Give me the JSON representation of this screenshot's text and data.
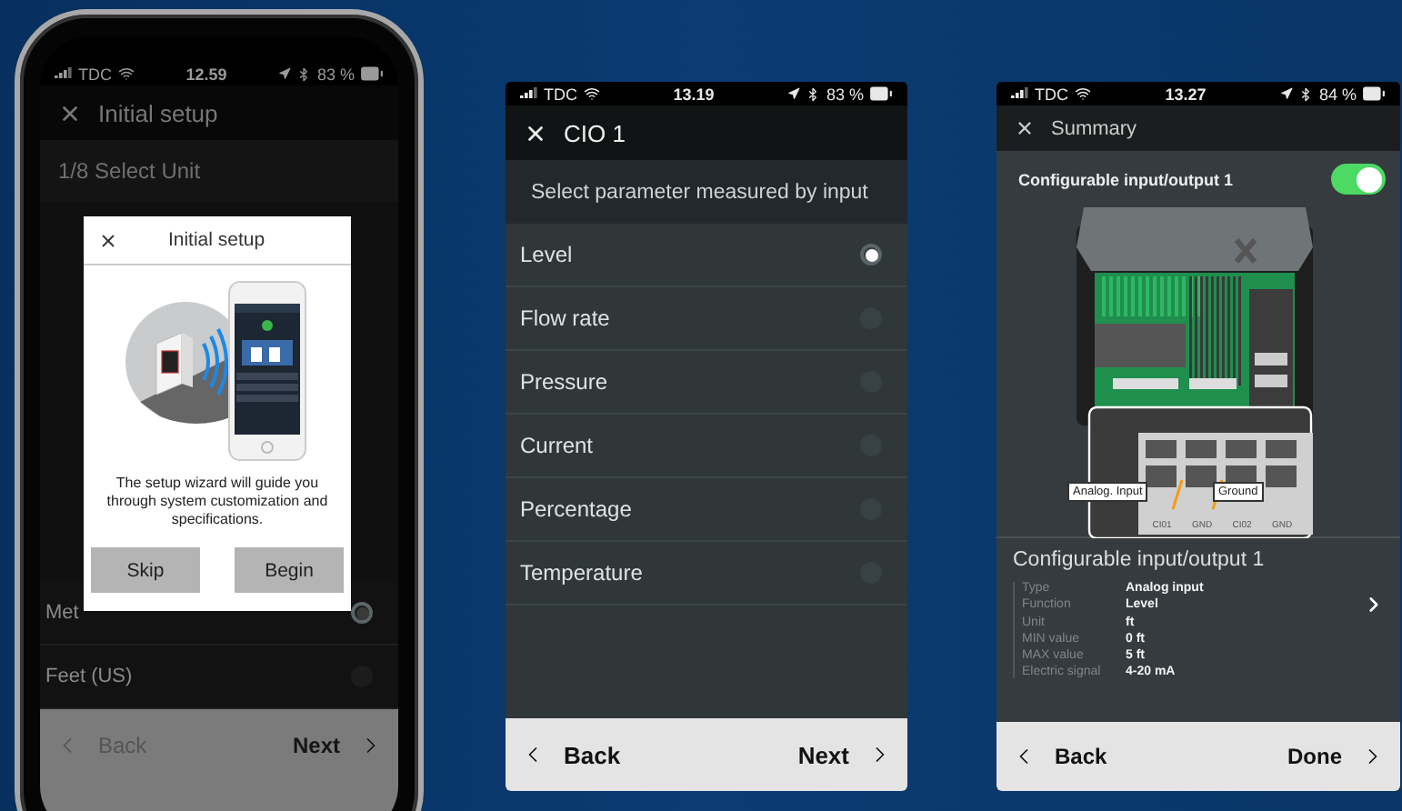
{
  "phones": [
    {
      "kind": "setup",
      "status": {
        "carrier": "TDC",
        "time": "12.59",
        "battery": "83 %"
      },
      "header": {
        "title": "Initial setup"
      },
      "step": "1/8 Select Unit",
      "options": [
        {
          "label": "Met",
          "selected": true
        },
        {
          "label": "Feet (US)",
          "selected": false
        }
      ],
      "footer": {
        "back": "Back",
        "next": "Next"
      },
      "dialog": {
        "title": "Initial setup",
        "message": "The setup wizard will guide you through system customization and specifications.",
        "buttons": [
          "Skip",
          "Begin"
        ]
      }
    },
    {
      "kind": "select",
      "status": {
        "carrier": "TDC",
        "time": "13.19",
        "battery": "83 %"
      },
      "header": {
        "title": "CIO 1"
      },
      "prompt": "Select parameter measured by input",
      "options": [
        {
          "label": "Level",
          "selected": true
        },
        {
          "label": "Flow rate",
          "selected": false
        },
        {
          "label": "Pressure",
          "selected": false
        },
        {
          "label": "Current",
          "selected": false
        },
        {
          "label": "Percentage",
          "selected": false
        },
        {
          "label": "Temperature",
          "selected": false
        }
      ],
      "footer": {
        "back": "Back",
        "next": "Next"
      }
    },
    {
      "kind": "summary",
      "status": {
        "carrier": "TDC",
        "time": "13.27",
        "battery": "84 %"
      },
      "header": {
        "title": "Summary"
      },
      "toggle": {
        "label": "Configurable input/output 1",
        "on": true
      },
      "diagram": {
        "callouts": [
          "Analog. Input",
          "Ground"
        ],
        "terminals": [
          "CI01",
          "GND",
          "CI02",
          "GND"
        ]
      },
      "section": {
        "title": "Configurable input/output 1",
        "fields": [
          {
            "label": "Type",
            "value": "Analog input"
          },
          {
            "label": "Function",
            "value": "Level"
          },
          {
            "label": "Unit",
            "value": "ft"
          },
          {
            "label": "MIN value",
            "value": "0 ft"
          },
          {
            "label": "MAX value",
            "value": "5 ft"
          },
          {
            "label": "Electric signal",
            "value": "4-20 mA"
          }
        ]
      },
      "footer": {
        "back": "Back",
        "next": "Done"
      }
    }
  ]
}
